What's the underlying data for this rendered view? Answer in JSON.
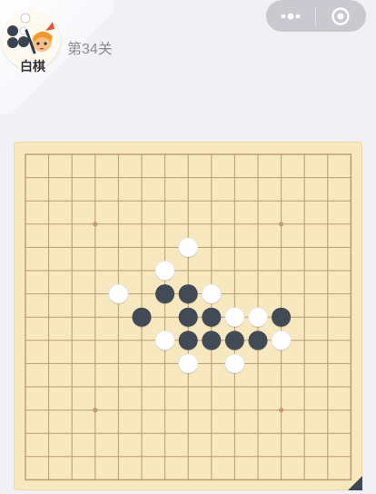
{
  "header": {
    "player_label": "白棋",
    "level_text": "第34关"
  },
  "icons": {
    "more": "more-dots-icon",
    "close": "close-target-icon"
  },
  "colors": {
    "background": "#f1f1f5",
    "board": "#f8e8c0",
    "grid_line": "#b99a72",
    "star_point": "#c09a74",
    "black_stone": "#414a55",
    "white_stone": "#ffffff",
    "capsule": "#c9c9cf"
  },
  "board": {
    "size": 15,
    "star_points": [
      [
        3,
        3
      ],
      [
        11,
        3
      ],
      [
        3,
        11
      ],
      [
        11,
        11
      ]
    ],
    "black_stones": [
      [
        6,
        6
      ],
      [
        7,
        6
      ],
      [
        5,
        7
      ],
      [
        7,
        7
      ],
      [
        8,
        7
      ],
      [
        11,
        7
      ],
      [
        7,
        8
      ],
      [
        8,
        8
      ],
      [
        9,
        8
      ],
      [
        10,
        8
      ]
    ],
    "white_stones": [
      [
        7,
        4
      ],
      [
        6,
        5
      ],
      [
        4,
        6
      ],
      [
        8,
        6
      ],
      [
        9,
        7
      ],
      [
        10,
        7
      ],
      [
        6,
        8
      ],
      [
        11,
        8
      ],
      [
        7,
        9
      ],
      [
        9,
        9
      ]
    ]
  }
}
